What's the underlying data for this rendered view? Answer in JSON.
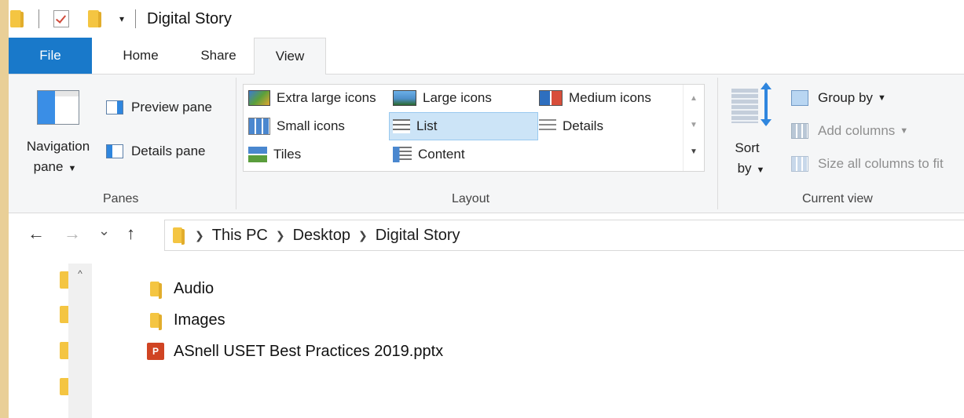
{
  "titlebar": {
    "title": "Digital Story",
    "qa_dropdown": "▾"
  },
  "tabs": {
    "file": "File",
    "home": "Home",
    "share": "Share",
    "view": "View"
  },
  "ribbon": {
    "panes": {
      "navigation_pane_line1": "Navigation",
      "navigation_pane_line2": "pane",
      "preview_pane": "Preview pane",
      "details_pane": "Details pane",
      "label": "Panes"
    },
    "layout": {
      "extra_large_icons": "Extra large icons",
      "large_icons": "Large icons",
      "medium_icons": "Medium icons",
      "small_icons": "Small icons",
      "list": "List",
      "details": "Details",
      "tiles": "Tiles",
      "content": "Content",
      "label": "Layout",
      "selected": "List"
    },
    "current_view": {
      "sort_by_line1": "Sort",
      "sort_by_line2": "by",
      "group_by": "Group by",
      "add_columns": "Add columns",
      "size_all_columns": "Size all columns to fit",
      "label": "Current view"
    }
  },
  "address": {
    "back": "←",
    "forward": "→",
    "recent": "⌄",
    "up": "↑",
    "crumbs": [
      "This PC",
      "Desktop",
      "Digital Story"
    ]
  },
  "files": [
    {
      "name": "Audio",
      "type": "folder"
    },
    {
      "name": "Images",
      "type": "folder"
    },
    {
      "name": "ASnell USET Best Practices 2019.pptx",
      "type": "pptx"
    }
  ],
  "colors": {
    "file_tab": "#1979ca",
    "selection": "#cce4f7",
    "folder": "#f4c542",
    "desktop": "#e9cf97"
  }
}
